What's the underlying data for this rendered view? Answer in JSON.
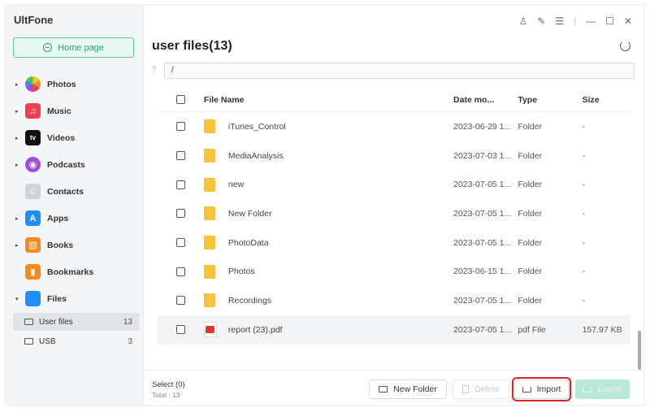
{
  "app": {
    "title": "UltFone"
  },
  "sidebar": {
    "home_label": "Home page",
    "items": [
      {
        "label": "Photos",
        "icon": "photos-icon",
        "caret": "▸"
      },
      {
        "label": "Music",
        "icon": "music-icon",
        "caret": "▸",
        "glyph": "♫"
      },
      {
        "label": "Videos",
        "icon": "videos-icon",
        "caret": "▸",
        "glyph": "tv"
      },
      {
        "label": "Podcasts",
        "icon": "podcasts-icon",
        "caret": "▸",
        "glyph": "◉"
      },
      {
        "label": "Contacts",
        "icon": "contacts-icon",
        "caret": "",
        "glyph": "☺"
      },
      {
        "label": "Apps",
        "icon": "apps-icon",
        "caret": "▸",
        "glyph": "A"
      },
      {
        "label": "Books",
        "icon": "books-icon",
        "caret": "▸",
        "glyph": "▥"
      },
      {
        "label": "Bookmarks",
        "icon": "bookmarks-icon",
        "caret": "",
        "glyph": "▮"
      },
      {
        "label": "Files",
        "icon": "files-icon",
        "caret": "▾",
        "glyph": ""
      }
    ],
    "sub_items": [
      {
        "label": "User files",
        "count": "13",
        "active": true
      },
      {
        "label": "USB",
        "count": "3",
        "active": false
      }
    ]
  },
  "header": {
    "title": "user files(13)",
    "path": "/",
    "back_glyph": "?"
  },
  "window_controls": {
    "user": "♙",
    "edit": "✎",
    "menu": "☰",
    "divider": "|",
    "minimize": "—",
    "maximize": "☐",
    "close": "✕"
  },
  "table": {
    "columns": {
      "name": "File Name",
      "date": "Date mo...",
      "type": "Type",
      "size": "Size"
    },
    "rows": [
      {
        "name": "iTunes_Control",
        "date": "2023-06-29 1...",
        "type": "Folder",
        "size": "-",
        "kind": "folder"
      },
      {
        "name": "MediaAnalysis",
        "date": "2023-07-03 1...",
        "type": "Folder",
        "size": "-",
        "kind": "folder"
      },
      {
        "name": "new",
        "date": "2023-07-05 1...",
        "type": "Folder",
        "size": "-",
        "kind": "folder"
      },
      {
        "name": "New Folder",
        "date": "2023-07-05 1...",
        "type": "Folder",
        "size": "-",
        "kind": "folder"
      },
      {
        "name": "PhotoData",
        "date": "2023-07-05 1...",
        "type": "Folder",
        "size": "-",
        "kind": "folder"
      },
      {
        "name": "Photos",
        "date": "2023-06-15 1...",
        "type": "Folder",
        "size": "-",
        "kind": "folder"
      },
      {
        "name": "Recordings",
        "date": "2023-07-05 1...",
        "type": "Folder",
        "size": "-",
        "kind": "folder"
      },
      {
        "name": "report (23).pdf",
        "date": "2023-07-05 1...",
        "type": "pdf File",
        "size": "157.97 KB",
        "kind": "pdf"
      }
    ]
  },
  "footer": {
    "select": "Select (0)",
    "total": "Total : 13",
    "new_folder": "New Folder",
    "delete": "Delete",
    "import": "Import",
    "export": "Export"
  },
  "colors": {
    "accent": "#5ec7a5",
    "highlight_outline": "#e02424",
    "folder": "#f6c33b"
  }
}
